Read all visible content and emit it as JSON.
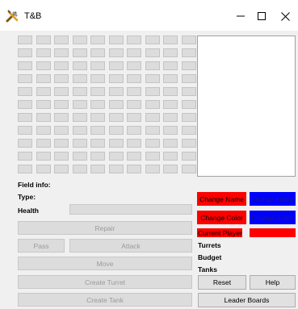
{
  "window": {
    "title": "T&B",
    "controls": {
      "minimize": "—",
      "maximize": "☐",
      "close": "✕"
    }
  },
  "board": {
    "rows": 11,
    "cols": 10
  },
  "field_info": {
    "heading": "Field info:",
    "type_label": "Type:",
    "health_label": "Health"
  },
  "actions": {
    "repair": "Repair",
    "pass": "Pass",
    "attack": "Attack",
    "move": "Move",
    "create_turret": "Create Turret",
    "create_tank": "Create Tank"
  },
  "player_panel": {
    "change_name_red": "Change Name",
    "change_name_blue": "Change Name",
    "change_color_red": "Change Color",
    "change_color_blue": "Change Color",
    "current_player": "Current Player",
    "current_player_color": "#ff0000",
    "turrets_label": "Turrets",
    "budget_label": "Budget",
    "tanks_label": "Tanks",
    "reset": "Reset",
    "help": "Help",
    "leader_boards": "Leader Boards"
  },
  "colors": {
    "player1": "#ff0000",
    "player2": "#0000ff"
  }
}
